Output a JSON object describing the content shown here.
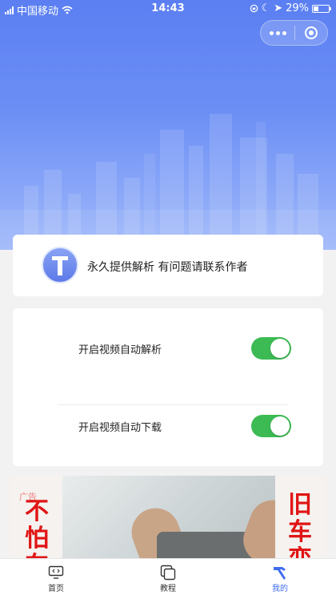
{
  "status_bar": {
    "carrier": "中国移动",
    "time": "14:43",
    "battery": "29%"
  },
  "header": {
    "menu_icon": "more-dots-icon",
    "close_icon": "target-close-icon"
  },
  "profile_card": {
    "avatar_letter": "T",
    "notice": "永久提供解析 有问题请联系作者"
  },
  "settings": [
    {
      "label": "开启视频自动解析",
      "enabled": true
    },
    {
      "label": "开启视频自动下载",
      "enabled": true
    }
  ],
  "ad_banner": {
    "tag": "广告",
    "left_text": "不怕车",
    "right_text": "旧车变"
  },
  "tabbar": {
    "items": [
      {
        "label": "首页",
        "icon": "monitor-code-icon"
      },
      {
        "label": "教程",
        "icon": "stacked-squares-icon"
      },
      {
        "label": "我的",
        "icon": "hammer-icon"
      }
    ],
    "active": "我的"
  },
  "colors": {
    "primary": "#5b7ff2",
    "switch_on": "#3cba53",
    "ad_red": "#e01515",
    "tab_active": "#3f6cf0"
  }
}
